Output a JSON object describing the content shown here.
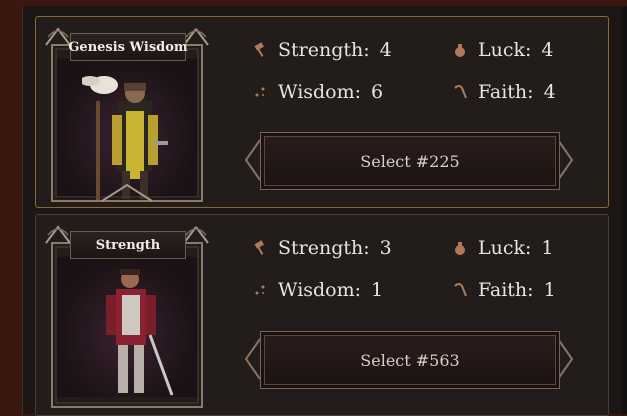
{
  "cards": [
    {
      "name": "Genesis Wisdom",
      "selected": true,
      "stats": {
        "strength": {
          "label": "Strength:",
          "value": "4"
        },
        "luck": {
          "label": "Luck:",
          "value": "4"
        },
        "wisdom": {
          "label": "Wisdom:",
          "value": "6"
        },
        "faith": {
          "label": "Faith:",
          "value": "4"
        }
      },
      "button": "Select #225"
    },
    {
      "name": "Strength",
      "selected": false,
      "stats": {
        "strength": {
          "label": "Strength:",
          "value": "3"
        },
        "luck": {
          "label": "Luck:",
          "value": "1"
        },
        "wisdom": {
          "label": "Wisdom:",
          "value": "1"
        },
        "faith": {
          "label": "Faith:",
          "value": "1"
        }
      },
      "button": "Select #563"
    }
  ],
  "icons": {
    "strength": "hammer-icon",
    "luck": "pouch-icon",
    "wisdom": "sparkle-icon",
    "faith": "staff-icon"
  },
  "colors": {
    "selected_border": "#8a6a32",
    "icon": "#b07a5a"
  }
}
